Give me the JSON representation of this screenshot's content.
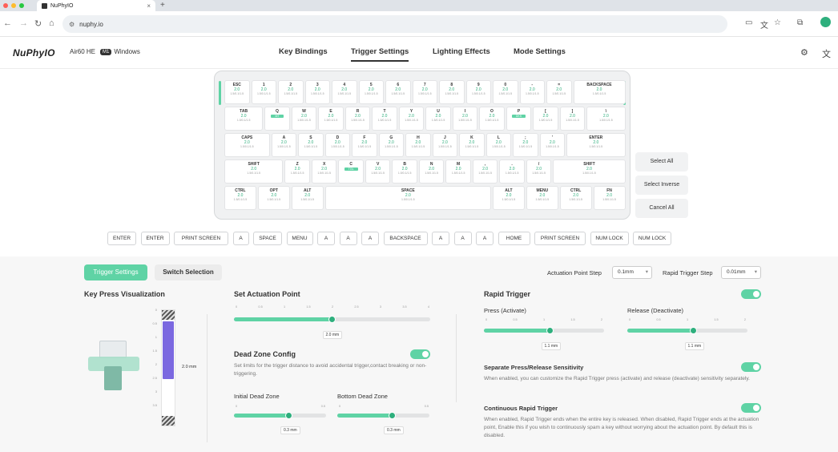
{
  "browser": {
    "tab_title": "NuPhyIO",
    "url": "nuphy.io"
  },
  "header": {
    "logo": "NuPhyIO",
    "model": "Air60 HE",
    "badge": "M1",
    "os": "Windows",
    "nav": [
      "Key Bindings",
      "Trigger Settings",
      "Lighting Effects",
      "Mode Settings"
    ]
  },
  "keyboard": {
    "rows": [
      [
        {
          "l": "ESC",
          "v": "2.0"
        },
        {
          "l": "1",
          "v": "2.0"
        },
        {
          "l": "2",
          "v": "2.0"
        },
        {
          "l": "3",
          "v": "2.0"
        },
        {
          "l": "4",
          "v": "2.0"
        },
        {
          "l": "5",
          "v": "2.0"
        },
        {
          "l": "6",
          "v": "2.0"
        },
        {
          "l": "7",
          "v": "2.0"
        },
        {
          "l": "8",
          "v": "2.0"
        },
        {
          "l": "9",
          "v": "2.0"
        },
        {
          "l": "0",
          "v": "2.0"
        },
        {
          "l": "-",
          "v": "2.0"
        },
        {
          "l": "=",
          "v": "2.0"
        },
        {
          "l": "BACKSPACE",
          "v": "2.0"
        }
      ],
      [
        {
          "l": "TAB",
          "v": "2.0"
        },
        {
          "l": "Q",
          "v": "",
          "b": "MT"
        },
        {
          "l": "W",
          "v": "2.0"
        },
        {
          "l": "E",
          "v": "2.0"
        },
        {
          "l": "R",
          "v": "2.0"
        },
        {
          "l": "T",
          "v": "2.0"
        },
        {
          "l": "Y",
          "v": "2.0"
        },
        {
          "l": "U",
          "v": "2.0"
        },
        {
          "l": "I",
          "v": "2.0"
        },
        {
          "l": "O",
          "v": "2.0"
        },
        {
          "l": "P",
          "v": "",
          "b": "DKS"
        },
        {
          "l": "[",
          "v": "2.0"
        },
        {
          "l": "]",
          "v": "2.0"
        },
        {
          "l": "\\",
          "v": "2.0"
        }
      ],
      [
        {
          "l": "CAPS",
          "v": "2.0"
        },
        {
          "l": "A",
          "v": "2.0"
        },
        {
          "l": "S",
          "v": "2.0"
        },
        {
          "l": "D",
          "v": "2.0"
        },
        {
          "l": "F",
          "v": "2.0"
        },
        {
          "l": "G",
          "v": "2.0"
        },
        {
          "l": "H",
          "v": "2.0"
        },
        {
          "l": "J",
          "v": "2.0"
        },
        {
          "l": "K",
          "v": "2.0"
        },
        {
          "l": "L",
          "v": "2.0"
        },
        {
          "l": ";",
          "v": "2.0"
        },
        {
          "l": "'",
          "v": "2.0"
        },
        {
          "l": "ENTER",
          "v": "2.0"
        }
      ],
      [
        {
          "l": "SHIFT",
          "v": "2.0"
        },
        {
          "l": "Z",
          "v": "2.0"
        },
        {
          "l": "X",
          "v": "2.0"
        },
        {
          "l": "C",
          "v": "",
          "b": "TGL"
        },
        {
          "l": "V",
          "v": "2.0"
        },
        {
          "l": "B",
          "v": "2.0"
        },
        {
          "l": "N",
          "v": "2.0"
        },
        {
          "l": "M",
          "v": "2.0"
        },
        {
          "l": ",",
          "v": "2.0"
        },
        {
          "l": ".",
          "v": "2.0"
        },
        {
          "l": "/",
          "v": "2.0"
        },
        {
          "l": "SHIFT",
          "v": "2.0"
        }
      ],
      [
        {
          "l": "CTRL",
          "v": "2.0"
        },
        {
          "l": "OPT",
          "v": "2.0"
        },
        {
          "l": "ALT",
          "v": "2.0"
        },
        {
          "l": "SPACE",
          "v": "2.0"
        },
        {
          "l": "ALT",
          "v": "2.0"
        },
        {
          "l": "MENU",
          "v": "2.0"
        },
        {
          "l": "CTRL",
          "v": "2.0"
        },
        {
          "l": "FN",
          "v": "2.0"
        }
      ]
    ],
    "rt_value": "1.5/0.1/1.5"
  },
  "side_buttons": [
    "Select All",
    "Select Inverse",
    "Cancel All"
  ],
  "layer_keys": [
    "ENTER",
    "ENTER",
    "PRINT SCREEN",
    "A",
    "SPACE",
    "MENU",
    "A",
    "A",
    "A",
    "BACKSPACE",
    "A",
    "A",
    "A",
    "HOME",
    "PRINT SCREEN",
    "NUM LOCK",
    "NUM LOCK"
  ],
  "settings": {
    "tab_active": "Trigger Settings",
    "tab_other": "Switch Selection",
    "ap_step_label": "Actuation Point Step",
    "ap_step_value": "0.1mm",
    "rt_step_label": "Rapid Trigger Step",
    "rt_step_value": "0.01mm",
    "kpv_title": "Key Press Visualization",
    "kpv_value": "2.0 mm",
    "kpv_ticks": [
      "0",
      "0.5",
      "1",
      "1.5",
      "2",
      "2.5",
      "3",
      "3.5"
    ],
    "sap_title": "Set Actuation Point",
    "sap_value": "2.0 mm",
    "sap_level": 0.5,
    "sap_ticks": [
      "0",
      "0.5",
      "1",
      "1.5",
      "2",
      "2.5",
      "3",
      "3.5",
      "4"
    ],
    "dz_title": "Dead Zone Config",
    "dz_desc": "Set limits for the trigger distance to avoid accidental trigger,contact breaking or non-triggering.",
    "idz_label": "Initial Dead Zone",
    "idz_value": "0.3 mm",
    "idz_level": 0.6,
    "bdz_label": "Bottom Dead Zone",
    "bdz_value": "0.3 mm",
    "bdz_level": 0.6,
    "dz_ticks": [
      "0",
      "0.5"
    ],
    "rt_title": "Rapid Trigger",
    "press_label": "Press (Activate)",
    "press_value": "1.1 mm",
    "press_level": 0.55,
    "release_label": "Release (Deactivate)",
    "release_value": "1.1 mm",
    "release_level": 0.55,
    "rt_ticks": [
      "0",
      "0.5",
      "1",
      "1.5",
      "2"
    ],
    "sep_title": "Separate Press/Release Sensitivity",
    "sep_desc": "When enabled, you can customize the Rapid Trigger press (activate) and release (deactivate) sensitivity separately.",
    "cont_title": "Continuous Rapid Trigger",
    "cont_desc": "When enabled, Rapid Trigger ends when the entire key is released. When disabled, Rapid Trigger ends at the actuation point, Enable this if you wish to continuously spam a key without worrying about the actuation point. By default this is disabled."
  },
  "colors": {
    "accent": "#5fd3a5",
    "accent_dark": "#2eaf7d"
  }
}
